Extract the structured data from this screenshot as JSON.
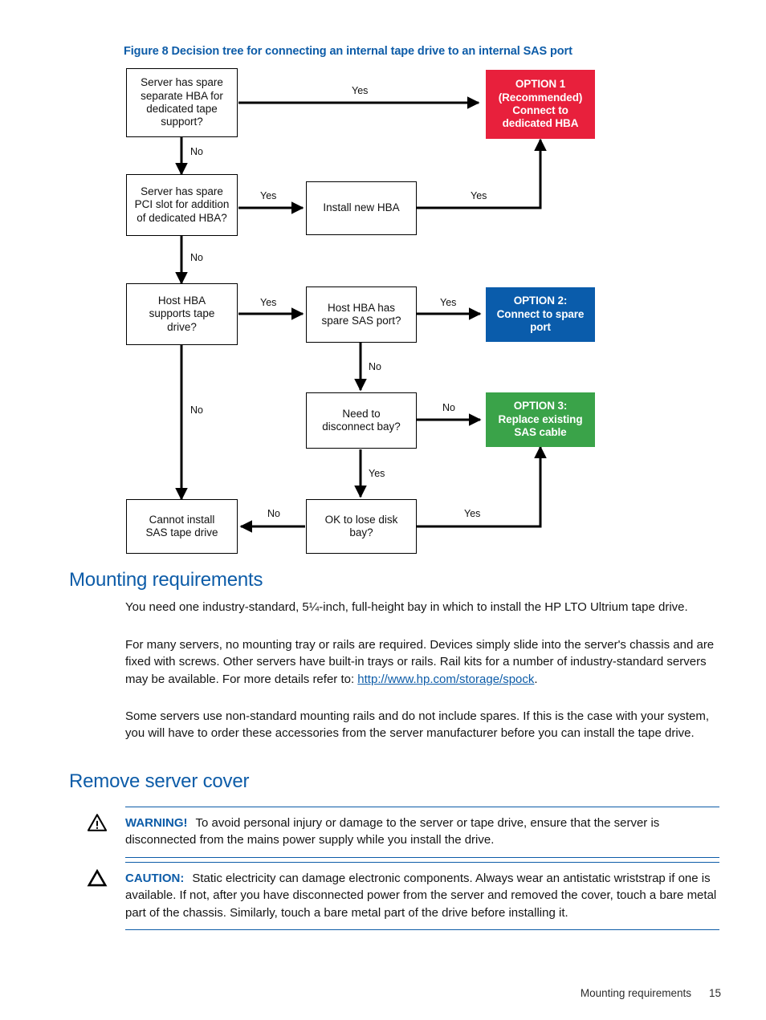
{
  "figure": {
    "caption": "Figure 8 Decision tree for connecting an internal tape drive to an internal SAS port",
    "nodes": {
      "n1": "Server has spare separate HBA for dedicated tape support?",
      "n2": "Server has spare PCI slot for addition of dedicated HBA?",
      "n3": "Install new HBA",
      "n4": "Host HBA supports tape drive?",
      "n5": "Host HBA has spare SAS port?",
      "n6": "Need to disconnect bay?",
      "n7": "Cannot install SAS tape drive",
      "n8": "OK to lose disk bay?",
      "opt1": "OPTION 1 (Recommended) Connect to dedicated HBA",
      "opt2": "OPTION 2: Connect to spare port",
      "opt3": "OPTION 3: Replace existing SAS cable"
    },
    "option_lines": {
      "opt1": [
        "OPTION 1",
        "(Recommended)",
        "Connect to",
        "dedicated HBA"
      ],
      "opt2": [
        "OPTION 2:",
        "Connect to spare",
        "port"
      ],
      "opt3": [
        "OPTION 3:",
        "Replace existing",
        "SAS cable"
      ]
    },
    "node_lines": {
      "n1": [
        "Server has spare",
        "separate HBA for",
        "dedicated tape",
        "support?"
      ],
      "n2": [
        "Server has spare",
        "PCI slot for addition",
        "of dedicated HBA?"
      ],
      "n3": [
        "Install new HBA"
      ],
      "n4": [
        "Host HBA",
        "supports tape",
        "drive?"
      ],
      "n5": [
        "Host HBA has",
        "spare SAS port?"
      ],
      "n6": [
        "Need to",
        "disconnect bay?"
      ],
      "n7": [
        "Cannot install",
        "SAS tape drive"
      ],
      "n8": [
        "OK to lose disk",
        "bay?"
      ]
    },
    "edges": {
      "e1_yes": "Yes",
      "e1_no": "No",
      "e2_yes": "Yes",
      "e2_no": "No",
      "e3_yes": "Yes",
      "e4_yes": "Yes",
      "e4_no": "No",
      "e5_yes": "Yes",
      "e5_no": "No",
      "e6_no": "No",
      "e6_yes": "Yes",
      "e8_no": "No",
      "e8_yes": "Yes"
    },
    "colors": {
      "option1": "#e8203c",
      "option2": "#0a5cab",
      "option3": "#3aa349",
      "caption": "#0d5ca8"
    }
  },
  "sections": {
    "mounting": {
      "heading": "Mounting requirements",
      "p1": "You need one industry-standard, 5¼-inch, full-height bay in which to install the HP LTO Ultrium tape drive.",
      "p2_before": "For many servers, no mounting tray or rails are required. Devices simply slide into the server's chassis and are fixed with screws. Other servers have built-in trays or rails. Rail kits for a number of industry-standard servers may be available. For more details refer to: ",
      "p2_link": "http://www.hp.com/storage/spock",
      "p2_after": ".",
      "p3": "Some servers use non-standard mounting rails and do not include spares. If this is the case with your system, you will have to order these accessories from the server manufacturer before you can install the tape drive."
    },
    "remove_cover": {
      "heading": "Remove server cover",
      "warning_label": "WARNING!",
      "warning_text": "To avoid personal injury or damage to the server or tape drive, ensure that the server is disconnected from the mains power supply while you install the drive.",
      "caution_label": "CAUTION:",
      "caution_text": "Static electricity can damage electronic components. Always wear an antistatic wriststrap if one is available. If not, after you have disconnected power from the server and removed the cover, touch a bare metal part of the chassis. Similarly, touch a bare metal part of the drive before installing it."
    }
  },
  "footer": {
    "section": "Mounting requirements",
    "page": "15"
  }
}
